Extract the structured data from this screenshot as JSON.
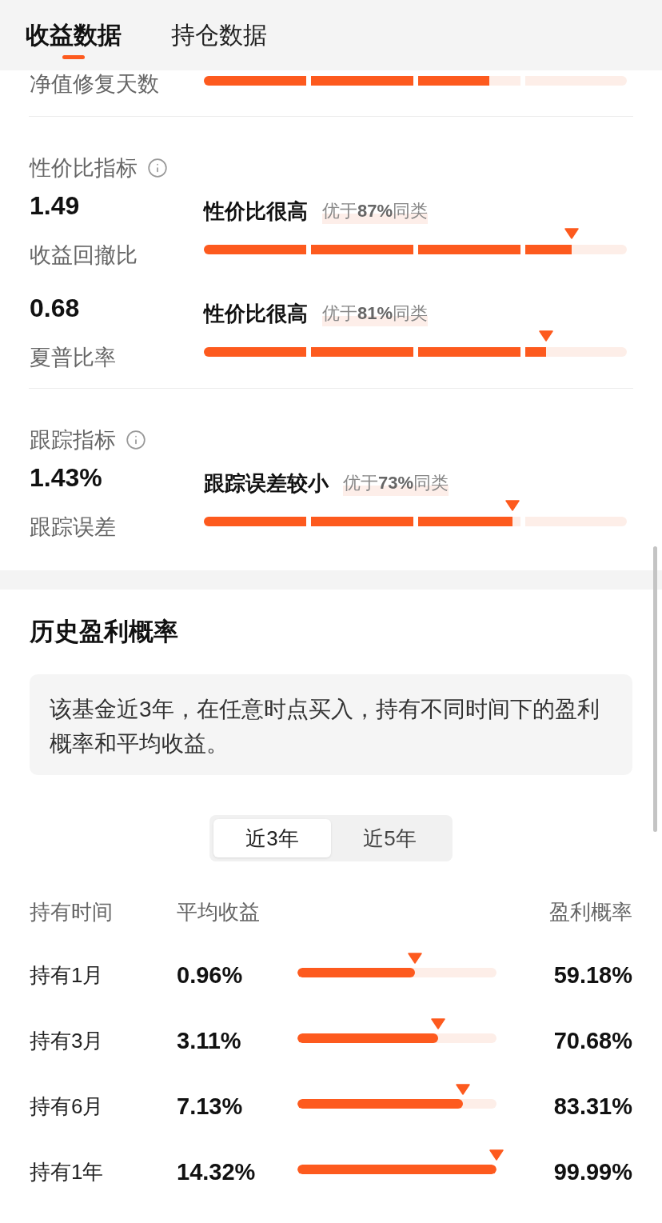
{
  "tabs": [
    {
      "label": "收益数据",
      "selected": true
    },
    {
      "label": "持仓数据",
      "selected": false
    }
  ],
  "recovery": {
    "label": "净值修复天数",
    "level": 0.675
  },
  "metric_groups": [
    {
      "title": "性价比指标",
      "metrics": [
        {
          "value": "1.49",
          "label": "收益回撤比",
          "verdict": "性价比很高",
          "rank": "优于**87%**同类",
          "level": 0.87
        },
        {
          "value": "0.68",
          "label": "夏普比率",
          "verdict": "性价比很高",
          "rank": "优于**81%**同类",
          "level": 0.81
        }
      ]
    },
    {
      "title": "跟踪指标",
      "metrics": [
        {
          "value": "1.43%",
          "label": "跟踪误差",
          "verdict": "跟踪误差较小",
          "rank": "优于**73%**同类",
          "level": 0.73
        }
      ]
    }
  ],
  "profit": {
    "title": "历史盈利概率",
    "note": "该基金近3年，在任意时点买入，持有不同时间下的盈利概率和平均收益。",
    "periods": [
      {
        "label": "近3年",
        "selected": true
      },
      {
        "label": "近5年",
        "selected": false
      }
    ],
    "columns": [
      "持有时间",
      "平均收益",
      "盈利概率"
    ],
    "rows": [
      {
        "holding": "持有1月",
        "avg_return": "0.96%",
        "level": 0.5918,
        "probability": "59.18%"
      },
      {
        "holding": "持有3月",
        "avg_return": "3.11%",
        "level": 0.7068,
        "probability": "70.68%"
      },
      {
        "holding": "持有6月",
        "avg_return": "7.13%",
        "level": 0.8331,
        "probability": "83.31%"
      },
      {
        "holding": "持有1年",
        "avg_return": "14.32%",
        "level": 0.9999,
        "probability": "99.99%"
      }
    ]
  }
}
